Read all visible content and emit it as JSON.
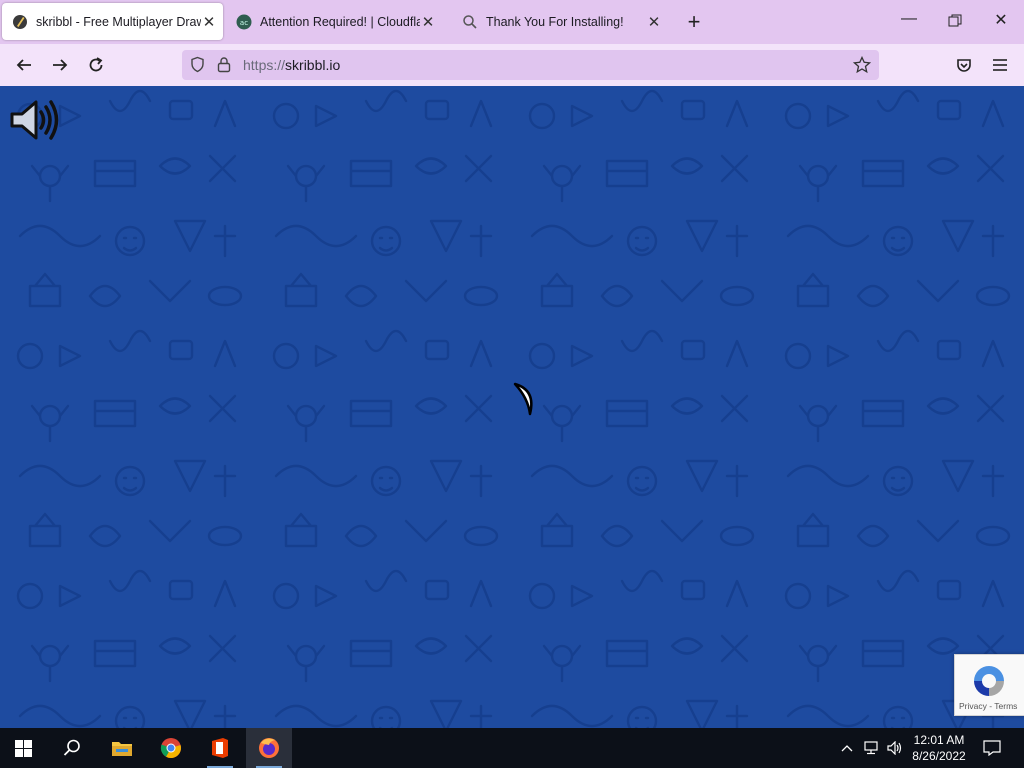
{
  "browser": {
    "tabs": [
      {
        "title": "skribbl - Free Multiplayer Drawing",
        "active": true,
        "icon": "skribbl-favicon"
      },
      {
        "title": "Attention Required! | Cloudflare",
        "active": false,
        "icon": "cloudflare-favicon"
      },
      {
        "title": "Thank You For Installing!",
        "active": false,
        "icon": "search-icon"
      }
    ],
    "new_tab_label": "+",
    "url_scheme": "https://",
    "url_host": "skribbl.io"
  },
  "page": {
    "background_color": "#1e4ba0",
    "pattern_color": "#163f8f",
    "sound_icon": "speaker-icon",
    "loading_icon": "spinner-icon"
  },
  "recaptcha": {
    "privacy": "Privacy",
    "separator": " - ",
    "terms": "Terms"
  },
  "taskbar": {
    "apps": [
      "windows-start-icon",
      "search-icon",
      "file-explorer-icon",
      "chrome-icon",
      "office-icon",
      "firefox-icon"
    ],
    "active_app": "firefox-icon",
    "time": "12:01 AM",
    "date": "8/26/2022"
  }
}
